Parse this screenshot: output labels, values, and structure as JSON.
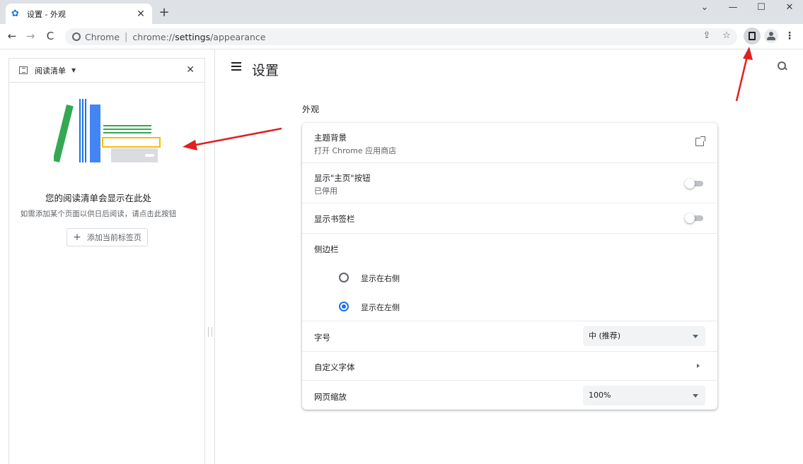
{
  "tab": {
    "title": "设置 - 外观"
  },
  "window": {
    "minimize": "—",
    "maximize": "☐",
    "close": "✕",
    "tabsearch": "⌄"
  },
  "omnibox": {
    "scheme_label": "Chrome",
    "url_host": "chrome://",
    "url_path_bold": "settings",
    "url_path_rest": "/appearance"
  },
  "sidepanel": {
    "dropdown_label": "阅读清单",
    "empty_title": "您的阅读清单会显示在此处",
    "empty_desc": "如需添加某个页面以供日后阅读，请点击此按钮",
    "add_button": "添加当前标签页"
  },
  "settings": {
    "title": "设置",
    "section": "外观",
    "theme": {
      "label": "主题背景",
      "sub": "打开 Chrome 应用商店"
    },
    "home_button": {
      "label": "显示\"主页\"按钮",
      "sub": "已停用"
    },
    "bookmarks_bar": {
      "label": "显示书签栏"
    },
    "side_panel": {
      "label": "侧边栏",
      "option_right": "显示在右侧",
      "option_left": "显示在左侧",
      "selected": "left"
    },
    "font_size": {
      "label": "字号",
      "value": "中 (推荐)"
    },
    "custom_fonts": {
      "label": "自定义字体"
    },
    "page_zoom": {
      "label": "网页缩放",
      "value": "100%"
    }
  },
  "colors": {
    "accent": "#1a73e8",
    "annotation": "#e02020"
  }
}
